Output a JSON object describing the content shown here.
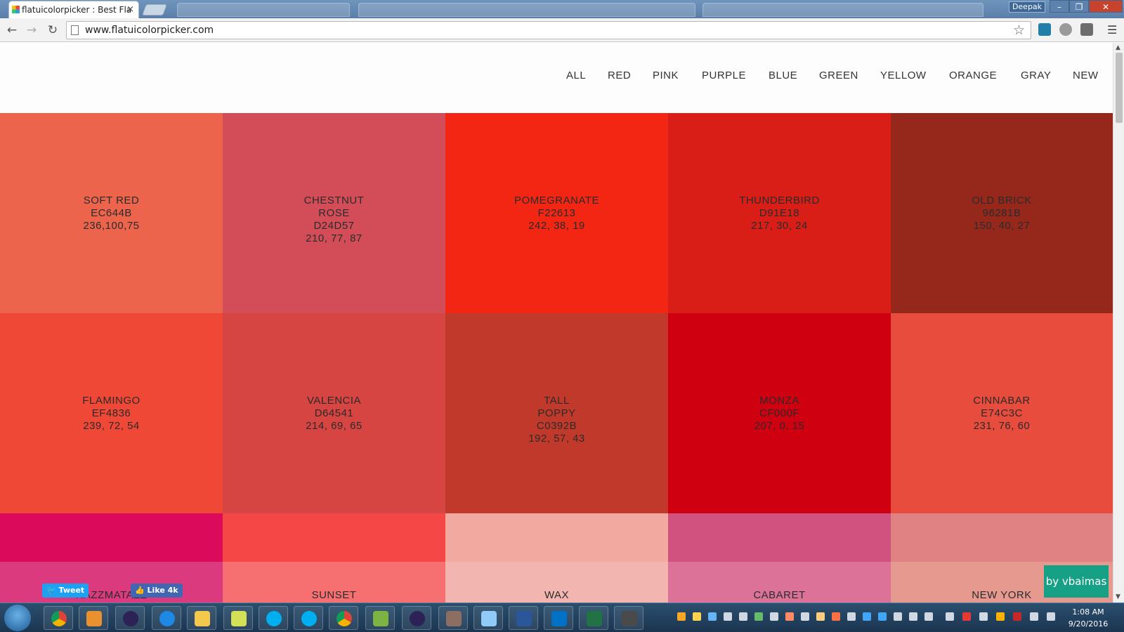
{
  "browser": {
    "active_tab_title": "flatuicolorpicker : Best Fla",
    "tab_close": "×",
    "user_name": "Deepak",
    "url": "www.flatuicolorpicker.com",
    "window_controls": {
      "minimize": "–",
      "restore": "❐",
      "close": "✕"
    }
  },
  "site": {
    "nav_items": [
      "ALL",
      "RED",
      "PINK",
      "PURPLE",
      "BLUE",
      "GREEN",
      "YELLOW",
      "ORANGE",
      "GRAY",
      "NEW"
    ],
    "rows": [
      [
        {
          "lines": [
            "SOFT RED",
            "EC644B",
            "236,100,75"
          ],
          "color": "#EC644B"
        },
        {
          "lines": [
            "CHESTNUT",
            "ROSE",
            "D24D57",
            "210, 77, 87"
          ],
          "color": "#D24D57"
        },
        {
          "lines": [
            "POMEGRANATE",
            "F22613",
            "242, 38, 19"
          ],
          "color": "#F22613"
        },
        {
          "lines": [
            "THUNDERBIRD",
            "D91E18",
            "217, 30, 24"
          ],
          "color": "#D91E18"
        },
        {
          "lines": [
            "OLD BRICK",
            "96281B",
            "150, 40, 27"
          ],
          "color": "#96281B"
        }
      ],
      [
        {
          "lines": [
            "FLAMINGO",
            "EF4836",
            "239, 72, 54"
          ],
          "color": "#EF4836"
        },
        {
          "lines": [
            "VALENCIA",
            "D64541",
            "214, 69, 65"
          ],
          "color": "#D64541"
        },
        {
          "lines": [
            "TALL",
            "POPPY",
            "C0392B",
            "192, 57, 43"
          ],
          "color": "#C0392B"
        },
        {
          "lines": [
            "MONZA",
            "CF000F",
            "207, 0, 15"
          ],
          "color": "#CF000F"
        },
        {
          "lines": [
            "CINNABAR",
            "E74C3C",
            "231, 76, 60"
          ],
          "color": "#E74C3C"
        }
      ]
    ],
    "partial_row_top_colors": [
      "#DB0A5B",
      "#F64747",
      "#F1A9A0",
      "#D2527F",
      "#E08283"
    ],
    "partial_row_bottom": [
      {
        "name": "RAZZMATAZZ",
        "color": "#DB3A7E"
      },
      {
        "name": "SUNSET",
        "color": "#F67071"
      },
      {
        "name": "WAX",
        "color": "#F3B5AF"
      },
      {
        "name": "CABARET",
        "color": "#DC7298"
      },
      {
        "name": "NEW YORK",
        "color": "#E6998E"
      }
    ],
    "share_tweet": "Tweet",
    "share_like": "Like 4k",
    "credit": "by vbaimas"
  },
  "taskbar": {
    "time": "1:08 AM",
    "date": "9/20/2016"
  }
}
